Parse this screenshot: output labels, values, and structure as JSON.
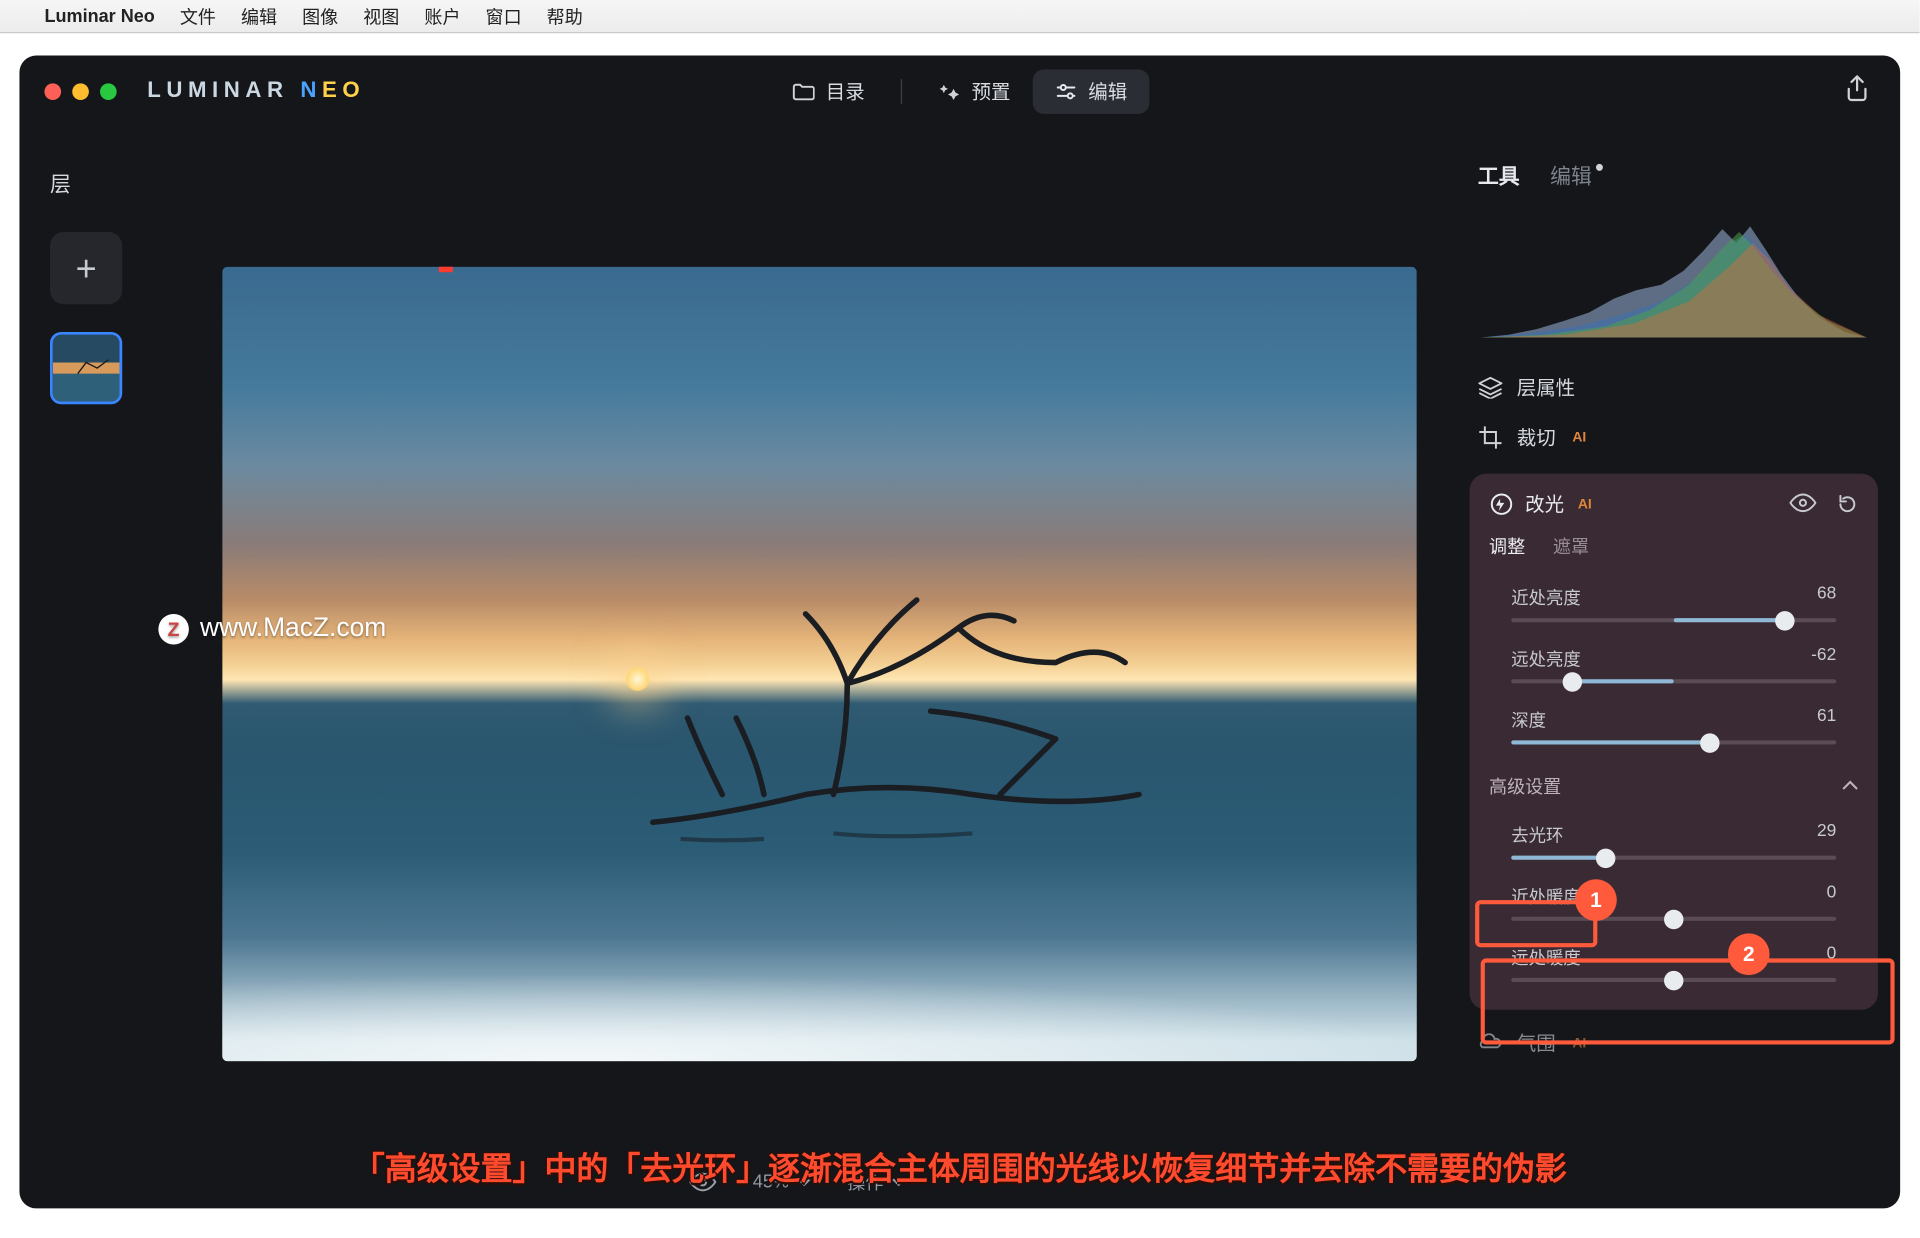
{
  "menubar": {
    "appname": "Luminar Neo",
    "items": [
      "文件",
      "编辑",
      "图像",
      "视图",
      "账户",
      "窗口",
      "帮助"
    ]
  },
  "brand": {
    "word1": "LUMINAR",
    "word2a": "N",
    "word2b": "EO"
  },
  "modes": {
    "catalog": "目录",
    "presets": "预置",
    "edit": "编辑"
  },
  "sidebar": {
    "layers_label": "层",
    "add": "+"
  },
  "panel": {
    "tabs": {
      "tools": "工具",
      "edits": "编辑"
    },
    "layer_props": "层属性",
    "crop": "裁切",
    "ai": "AI"
  },
  "relight": {
    "title": "改光",
    "subtabs": {
      "adjust": "调整",
      "mask": "遮罩"
    },
    "sliders": {
      "near_brightness": {
        "label": "近处亮度",
        "value": 68,
        "min": -100,
        "max": 100
      },
      "far_brightness": {
        "label": "远处亮度",
        "value": -62,
        "min": -100,
        "max": 100
      },
      "depth": {
        "label": "深度",
        "value": 61,
        "min": 0,
        "max": 100
      }
    },
    "advanced": {
      "label": "高级设置",
      "dehalo": {
        "label": "去光环",
        "value": 29,
        "min": 0,
        "max": 100
      },
      "near_warmth": {
        "label": "近处暖度",
        "value": 0,
        "min": -100,
        "max": 100
      },
      "far_warmth": {
        "label": "远处暖度",
        "value": 0,
        "min": -100,
        "max": 100
      }
    },
    "atmosphere": "气围"
  },
  "bottombar": {
    "zoom": "45%",
    "actions": "操作"
  },
  "watermark": "www.MacZ.com",
  "annotations": {
    "b1": "1",
    "b2": "2"
  },
  "caption": "「高级设置」中的「去光环」逐渐混合主体周围的光线以恢复细节并去除不需要的伪影"
}
